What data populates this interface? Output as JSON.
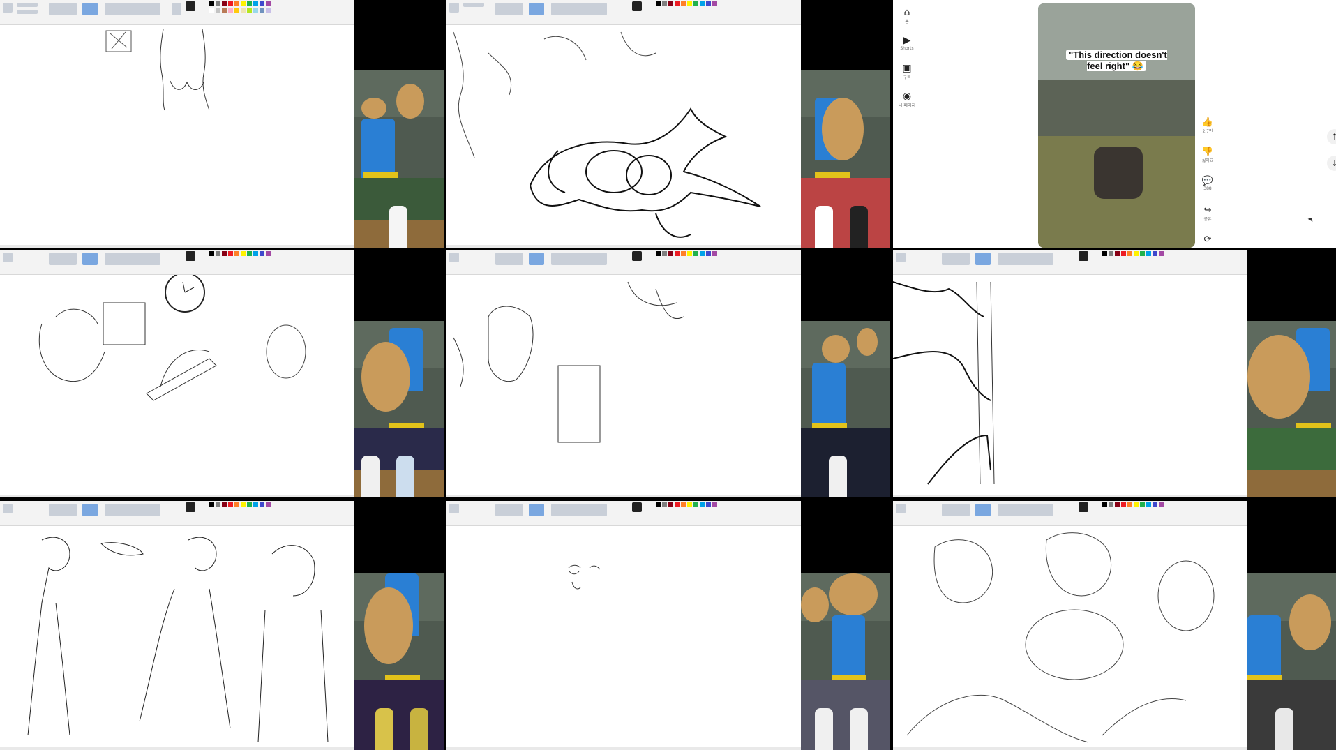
{
  "short": {
    "caption": "\"This direction doesn't feel right\" 😂",
    "likes": "2.7만",
    "dislike_label": "싫어요",
    "comments": "388",
    "share_label": "공유"
  },
  "sidebar": {
    "items": [
      {
        "icon": "home-icon",
        "label": "홈"
      },
      {
        "icon": "shorts-icon",
        "label": "Shorts"
      },
      {
        "icon": "subscriptions-icon",
        "label": "구독"
      },
      {
        "icon": "account-icon",
        "label": "내 페이지"
      }
    ]
  },
  "colors": {
    "paint_toolbar": "#f3f3f3",
    "canvas": "#ffffff",
    "slide_blue": "#2a7fd4",
    "dog": "#c99b5b"
  }
}
